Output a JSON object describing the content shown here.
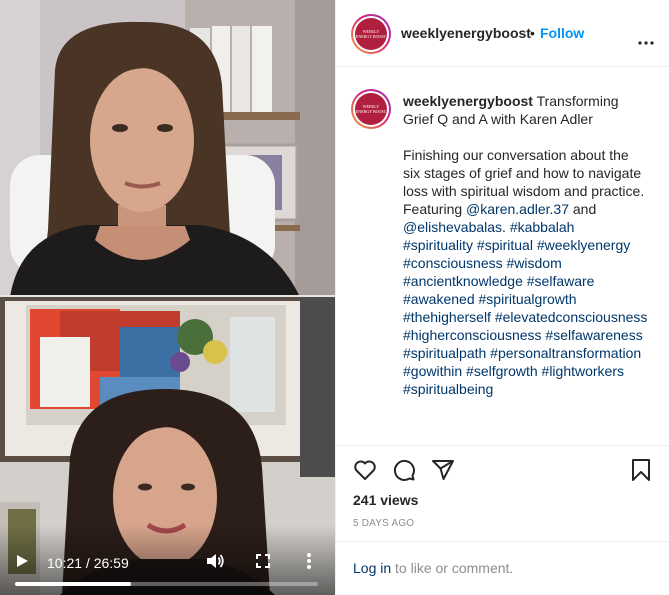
{
  "account": {
    "username": "weeklyenergyboost",
    "separator": "•",
    "follow_label": "Follow",
    "avatar_text": "WEEKLY ENERGY BOOST"
  },
  "caption": {
    "username": "weeklyenergyboost",
    "title": "Transforming Grief Q and A with Karen Adler",
    "body": "Finishing our conversation about the six stages of grief and how to navigate loss with spiritual wisdom and practice. Featuring",
    "mention_1": "@karen.adler.37",
    "and_text": "and",
    "mention_2": "@elishevabalas",
    "period": ".",
    "hashtags": [
      "#kabbalah",
      "#spirituality",
      "#spiritual",
      "#weeklyenergy",
      "#consciousness",
      "#wisdom",
      "#ancientknowledge",
      "#selfaware",
      "#awakened",
      "#spiritualgrowth",
      "#thehigherself",
      "#elevatedconsciousness",
      "#higherconsciousness",
      "#selfawareness",
      "#spiritualpath",
      "#personaltransformation",
      "#gowithin",
      "#selfgrowth",
      "#lightworkers",
      "#spiritualbeing"
    ]
  },
  "stats": {
    "views": "241 views",
    "posted": "5 DAYS AGO"
  },
  "login": {
    "link": "Log in",
    "text": " to like or comment."
  },
  "player": {
    "time": "10:21 / 26:59",
    "progress": 0.383
  },
  "colors": {
    "follow_blue": "#0095f6",
    "link_navy": "#00376b",
    "muted_gray": "#8e8e8e",
    "avatar_red": "#b11f3f"
  },
  "icons": [
    "play-icon",
    "volume-icon",
    "fullscreen-icon",
    "more-vertical-icon",
    "more-horizontal-icon",
    "heart-icon",
    "comment-icon",
    "share-icon",
    "bookmark-icon"
  ]
}
